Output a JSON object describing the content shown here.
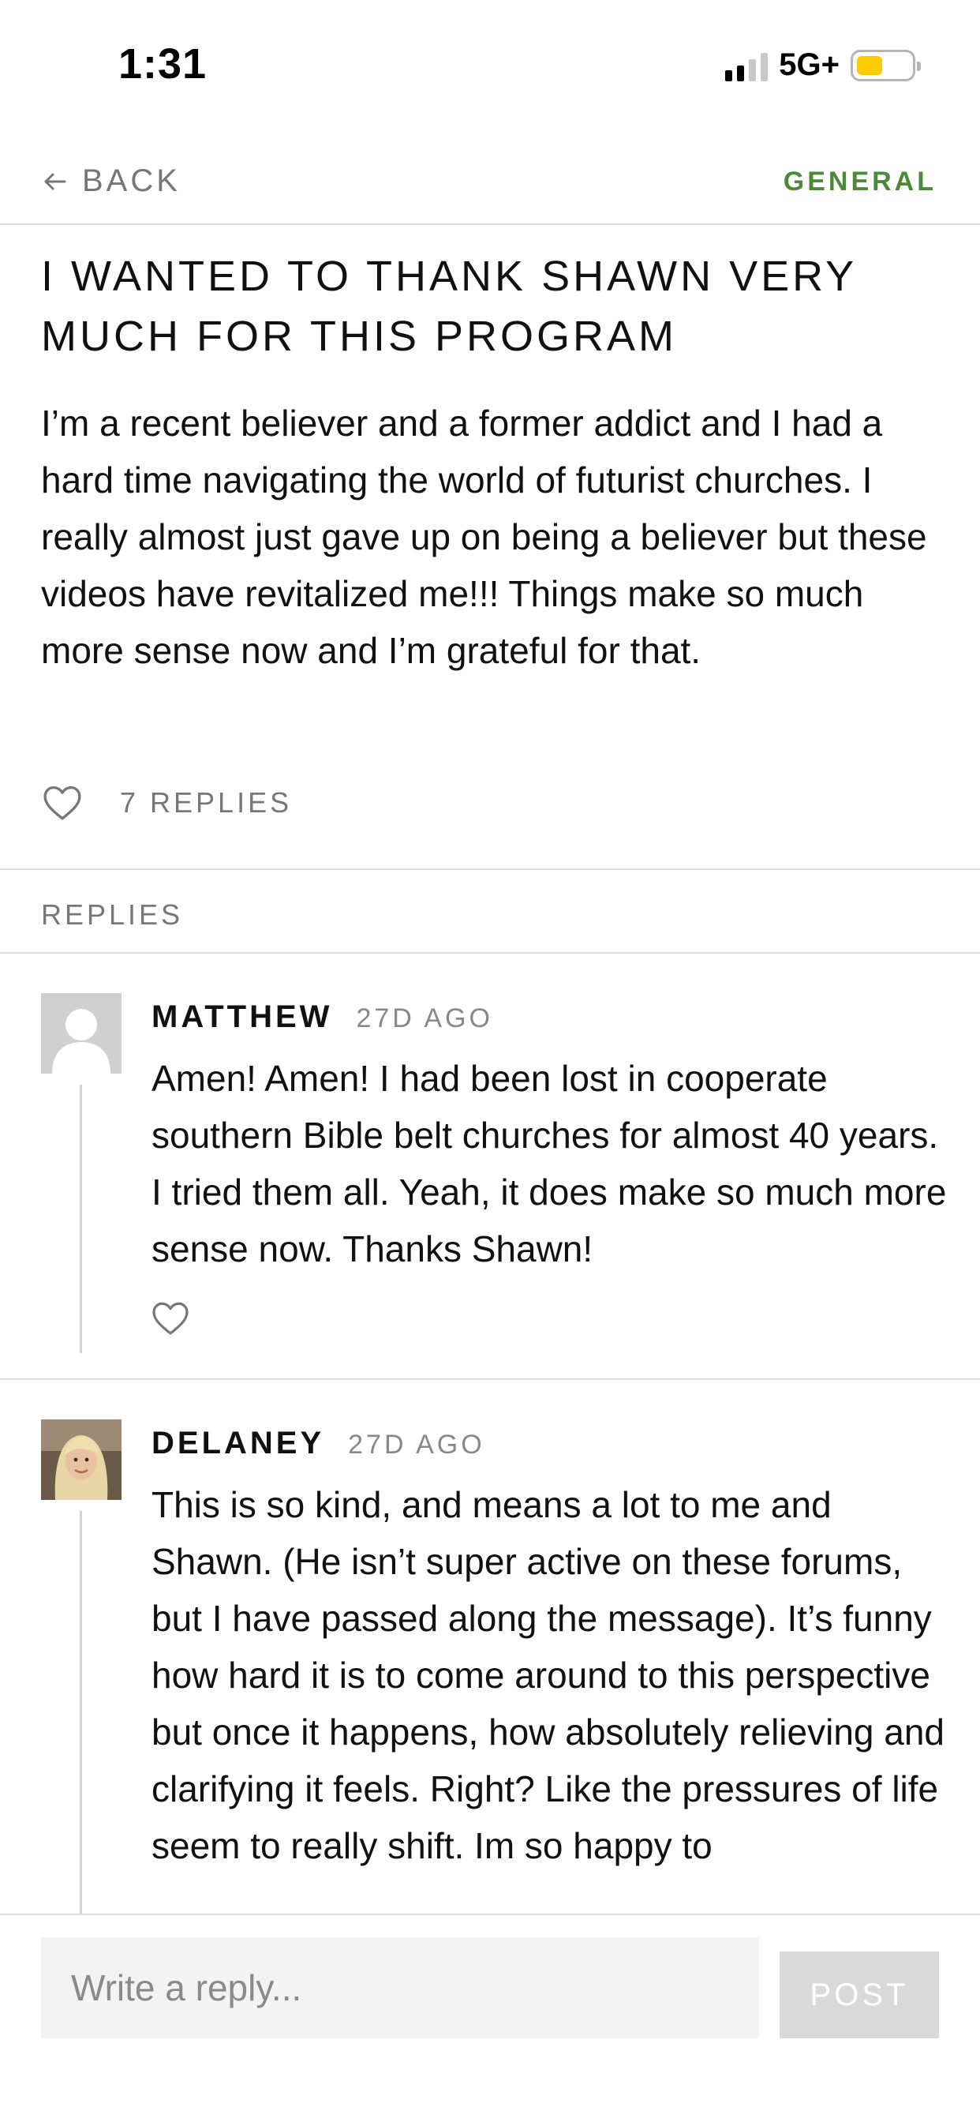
{
  "status_bar": {
    "time": "1:31",
    "network": "5G+"
  },
  "nav": {
    "back_label": "BACK",
    "category": "GENERAL"
  },
  "post": {
    "title": "I WANTED TO THANK SHAWN VERY MUCH FOR THIS PROGRAM",
    "body": "I’m a recent believer and a former addict and I had a hard time navigating the world of futurist churches. I really almost just gave up on being a believer but these videos have revitalized me!!! Things make so much more sense now and I’m grateful for that.",
    "reply_count_label": "7 REPLIES"
  },
  "replies_header": "REPLIES",
  "replies": [
    {
      "author": "MATTHEW",
      "time": "27D AGO",
      "body": "Amen! Amen! I had been lost in cooperate southern Bible belt churches for almost 40 years. I tried them all. Yeah, it does make so much more sense now. Thanks Shawn!"
    },
    {
      "author": "DELANEY",
      "time": "27D AGO",
      "body": "This is so kind, and means a lot to me and Shawn. (He isn’t super active on these forums, but I have passed along the message). It’s funny how hard it is to come around to this perspective but once it happens, how absolutely relieving and clarifying it feels. Right? Like the pressures of life seem to really shift. Im so happy to"
    }
  ],
  "composer": {
    "placeholder": "Write a reply...",
    "post_label": "POST"
  },
  "colors": {
    "accent": "#4c8a3a",
    "muted": "#777777",
    "divider": "#dddddd",
    "battery": "#ffcc00"
  },
  "icons": [
    "back-arrow-icon",
    "heart-icon",
    "signal-icon",
    "battery-icon",
    "default-avatar-icon"
  ]
}
